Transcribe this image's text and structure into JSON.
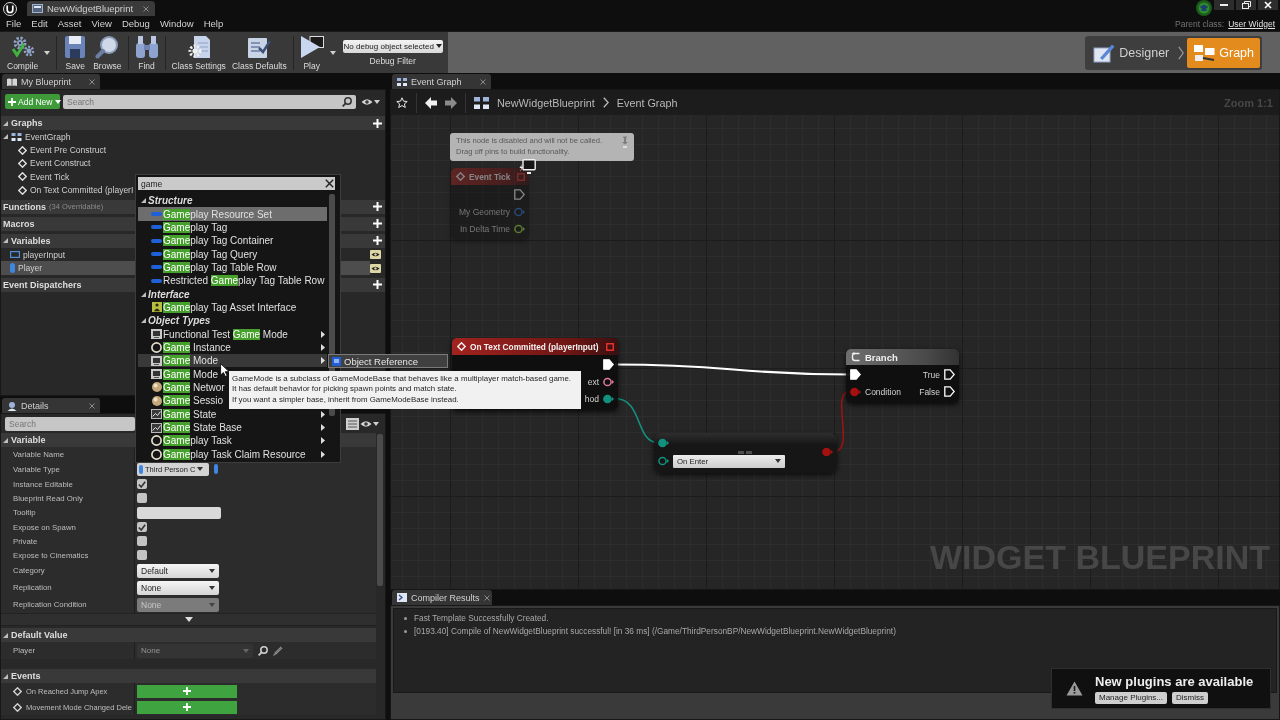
{
  "window": {
    "tab": "NewWidgetBlueprint",
    "parent_class_label": "Parent class:",
    "parent_class": "User Widget"
  },
  "menu": [
    "File",
    "Edit",
    "Asset",
    "View",
    "Debug",
    "Window",
    "Help"
  ],
  "toolbar": {
    "groups": [
      [
        {
          "label": "Compile",
          "kind": "compile",
          "dropdown": true
        }
      ],
      [
        {
          "label": "Save",
          "kind": "save",
          "dropdown": false
        },
        {
          "label": "Browse",
          "kind": "browse",
          "dropdown": false
        }
      ],
      [
        {
          "label": "Find",
          "kind": "find",
          "dropdown": false
        }
      ],
      [
        {
          "label": "Class Settings",
          "kind": "settings",
          "dropdown": false
        },
        {
          "label": "Class Defaults",
          "kind": "defaults",
          "dropdown": false
        }
      ],
      [
        {
          "label": "Play",
          "kind": "play",
          "dropdown": true
        }
      ]
    ],
    "debug_object": "No debug object selected",
    "debug_label": "Debug Filter"
  },
  "modes": [
    {
      "label": "Designer",
      "kind": "designer",
      "selected": false
    },
    {
      "label": "Graph",
      "kind": "graph",
      "selected": true
    }
  ],
  "my_blueprint": {
    "tab": "My Blueprint",
    "add_new": "Add New",
    "search_placeholder": "Search",
    "sections": [
      {
        "title": "Graphs",
        "expanded": true,
        "addable": true,
        "items": [
          {
            "label": "EventGraph",
            "kind": "graph",
            "expanded": true,
            "children": [
              {
                "label": "Event Pre Construct",
                "kind": "event"
              },
              {
                "label": "Event Construct",
                "kind": "event"
              },
              {
                "label": "Event Tick",
                "kind": "event"
              },
              {
                "label": "On Text Committed (playerI",
                "kind": "event"
              }
            ]
          }
        ]
      },
      {
        "title": "Functions",
        "note": "(34 Overridable)",
        "addable": true
      },
      {
        "title": "Macros",
        "addable": true
      },
      {
        "title": "Variables",
        "expanded": true,
        "addable": true,
        "items": [
          {
            "label": "playerInput",
            "kind": "widget",
            "selected": false,
            "public": true
          },
          {
            "label": "Player",
            "kind": "object",
            "selected": true,
            "public": true
          }
        ]
      },
      {
        "title": "Event Dispatchers",
        "addable": true
      }
    ]
  },
  "details": {
    "tab": "Details",
    "search_placeholder": "Search",
    "sections": [
      {
        "title": "Variable",
        "expanded": true,
        "advanced": true,
        "rows": [
          {
            "label": "Variable Name",
            "kind": "label"
          },
          {
            "label": "Variable Type",
            "kind": "type",
            "value": "Third Person C"
          },
          {
            "label": "Instance Editable",
            "kind": "check",
            "checked": true
          },
          {
            "label": "Blueprint Read Only",
            "kind": "check",
            "checked": false
          },
          {
            "label": "Tooltip",
            "kind": "input"
          },
          {
            "label": "Expose on Spawn",
            "kind": "check",
            "checked": true
          },
          {
            "label": "Private",
            "kind": "check",
            "checked": false
          },
          {
            "label": "Expose to Cinematics",
            "kind": "check",
            "checked": false
          },
          {
            "label": "Category",
            "kind": "select",
            "value": "Default",
            "disabled": false
          },
          {
            "label": "Replication",
            "kind": "select",
            "value": "None",
            "disabled": false
          },
          {
            "label": "Replication Condition",
            "kind": "select",
            "value": "None",
            "disabled": true
          }
        ]
      },
      {
        "title": "Default Value",
        "expanded": true,
        "advanced": false,
        "rows": [
          {
            "label": "Player",
            "kind": "object",
            "value": "None",
            "disabled": true
          }
        ]
      },
      {
        "title": "Events",
        "expanded": true,
        "advanced": false,
        "rows": [
          {
            "label": "On Reached Jump Apex",
            "kind": "event"
          },
          {
            "label": "Movement Mode Changed Dele",
            "kind": "event"
          }
        ]
      }
    ]
  },
  "action_menu": {
    "search": "game",
    "groups": [
      {
        "title": "Structure",
        "expanded": true,
        "items": [
          {
            "parts": [
              {
                "text": "Game",
                "match": true
              },
              {
                "text": "play Resource Set",
                "match": false
              }
            ],
            "kind": "struct",
            "selected": true,
            "hovered": false,
            "submenu": false
          },
          {
            "parts": [
              {
                "text": "Game",
                "match": true
              },
              {
                "text": "play Tag",
                "match": false
              }
            ],
            "kind": "struct",
            "selected": false,
            "hovered": false,
            "submenu": false
          },
          {
            "parts": [
              {
                "text": "Game",
                "match": true
              },
              {
                "text": "play Tag Container",
                "match": false
              }
            ],
            "kind": "struct",
            "selected": false,
            "hovered": false,
            "submenu": false
          },
          {
            "parts": [
              {
                "text": "Game",
                "match": true
              },
              {
                "text": "play Tag Query",
                "match": false
              }
            ],
            "kind": "struct",
            "selected": false,
            "hovered": false,
            "submenu": false
          },
          {
            "parts": [
              {
                "text": "Game",
                "match": true
              },
              {
                "text": "play Tag Table Row",
                "match": false
              }
            ],
            "kind": "struct",
            "selected": false,
            "hovered": false,
            "submenu": false
          },
          {
            "parts": [
              {
                "text": "Restricted ",
                "match": false
              },
              {
                "text": "Game",
                "match": true
              },
              {
                "text": "play Tag Table Row",
                "match": false
              }
            ],
            "kind": "struct",
            "selected": false,
            "hovered": false,
            "submenu": false
          }
        ]
      },
      {
        "title": "Interface",
        "expanded": true,
        "items": [
          {
            "parts": [
              {
                "text": "Game",
                "match": true
              },
              {
                "text": "play Tag Asset Interface",
                "match": false
              }
            ],
            "kind": "interface",
            "selected": false,
            "hovered": false,
            "submenu": false
          }
        ]
      },
      {
        "title": "Object Types",
        "expanded": true,
        "items": [
          {
            "parts": [
              {
                "text": "Functional Test ",
                "match": false
              },
              {
                "text": "Game",
                "match": true
              },
              {
                "text": " Mode",
                "match": false
              }
            ],
            "kind": "mode",
            "selected": false,
            "hovered": false,
            "submenu": true
          },
          {
            "parts": [
              {
                "text": "Game",
                "match": true
              },
              {
                "text": " Instance",
                "match": false
              }
            ],
            "kind": "object",
            "selected": false,
            "hovered": false,
            "submenu": true
          },
          {
            "parts": [
              {
                "text": "Game",
                "match": true
              },
              {
                "text": " Mode",
                "match": false
              }
            ],
            "kind": "mode",
            "selected": false,
            "hovered": true,
            "submenu": true
          },
          {
            "parts": [
              {
                "text": "Game",
                "match": true
              },
              {
                "text": " Mode",
                "match": false
              }
            ],
            "kind": "mode",
            "selected": false,
            "hovered": false,
            "submenu": false
          },
          {
            "parts": [
              {
                "text": "Game",
                "match": true
              },
              {
                "text": " Networ",
                "match": false
              }
            ],
            "kind": "info",
            "selected": false,
            "hovered": false,
            "submenu": false
          },
          {
            "parts": [
              {
                "text": "Game",
                "match": true
              },
              {
                "text": " Sessio",
                "match": false
              }
            ],
            "kind": "info",
            "selected": false,
            "hovered": false,
            "submenu": false
          },
          {
            "parts": [
              {
                "text": "Game",
                "match": true
              },
              {
                "text": " State",
                "match": false
              }
            ],
            "kind": "state",
            "selected": false,
            "hovered": false,
            "submenu": true
          },
          {
            "parts": [
              {
                "text": "Game",
                "match": true
              },
              {
                "text": " State Base",
                "match": false
              }
            ],
            "kind": "state",
            "selected": false,
            "hovered": false,
            "submenu": true
          },
          {
            "parts": [
              {
                "text": "Game",
                "match": true
              },
              {
                "text": "play Task",
                "match": false
              }
            ],
            "kind": "object",
            "selected": false,
            "hovered": false,
            "submenu": true
          },
          {
            "parts": [
              {
                "text": "Game",
                "match": true
              },
              {
                "text": "play Task Claim Resource",
                "match": false
              }
            ],
            "kind": "object",
            "selected": false,
            "hovered": false,
            "submenu": true
          }
        ]
      }
    ]
  },
  "submenu_popup": {
    "label": "Object Reference"
  },
  "tooltip": {
    "text": "GameMode is a subclass of GameModeBase that behaves like a multiplayer match-based game.\nIt has default behavior for picking spawn points and match state.\nIf you want a simpler base, inherit from GameModeBase instead."
  },
  "graph": {
    "tab": "Event Graph",
    "breadcrumb": [
      "NewWidgetBlueprint",
      "Event Graph"
    ],
    "zoom": "Zoom 1:1",
    "label": "WIDGET BLUEPRINT",
    "nodes": [
      {
        "kind": "event",
        "title": "Event Tick",
        "disabled": true,
        "comment": "This node is disabled and will not be called.\nDrag off pins to build functionality.",
        "outputs": [
          {
            "kind": "exec",
            "connected": false
          },
          {
            "label": "My Geometry",
            "kind": "struct",
            "connected": false
          },
          {
            "label": "In Delta Time",
            "kind": "float",
            "connected": false
          }
        ]
      },
      {
        "kind": "event",
        "title": "On Text Committed (playerInput)",
        "disabled": false,
        "outputs": [
          {
            "kind": "exec",
            "connected": true
          },
          {
            "label": "ext",
            "kind": "text",
            "connected": false
          },
          {
            "label": "hod",
            "kind": "enum",
            "connected": true
          }
        ]
      },
      {
        "kind": "flow",
        "title": "Branch",
        "disabled": false,
        "inputs": [
          {
            "kind": "exec",
            "connected": true
          },
          {
            "label": "Condition",
            "kind": "bool",
            "connected": true
          }
        ],
        "outputs": [
          {
            "label": "True",
            "kind": "exec",
            "connected": false
          },
          {
            "label": "False",
            "kind": "exec",
            "connected": false
          }
        ]
      },
      {
        "kind": "compact",
        "disabled": false,
        "inputs": [
          {
            "kind": "enum",
            "connected": true
          },
          {
            "kind": "enum",
            "connected": false,
            "value": "On Enter"
          }
        ],
        "outputs": [
          {
            "kind": "bool",
            "connected": true
          }
        ]
      }
    ]
  },
  "compiler": {
    "tab": "Compiler Results",
    "messages": [
      "Fast Template Successfully Created.",
      "[0193.40] Compile of NewWidgetBlueprint successful! [in 36 ms] (/Game/ThirdPersonBP/NewWidgetBlueprint.NewWidgetBlueprint)"
    ]
  },
  "notification": {
    "title": "New plugins are available",
    "buttons": [
      "Manage Plugins...",
      "Dismiss"
    ]
  }
}
